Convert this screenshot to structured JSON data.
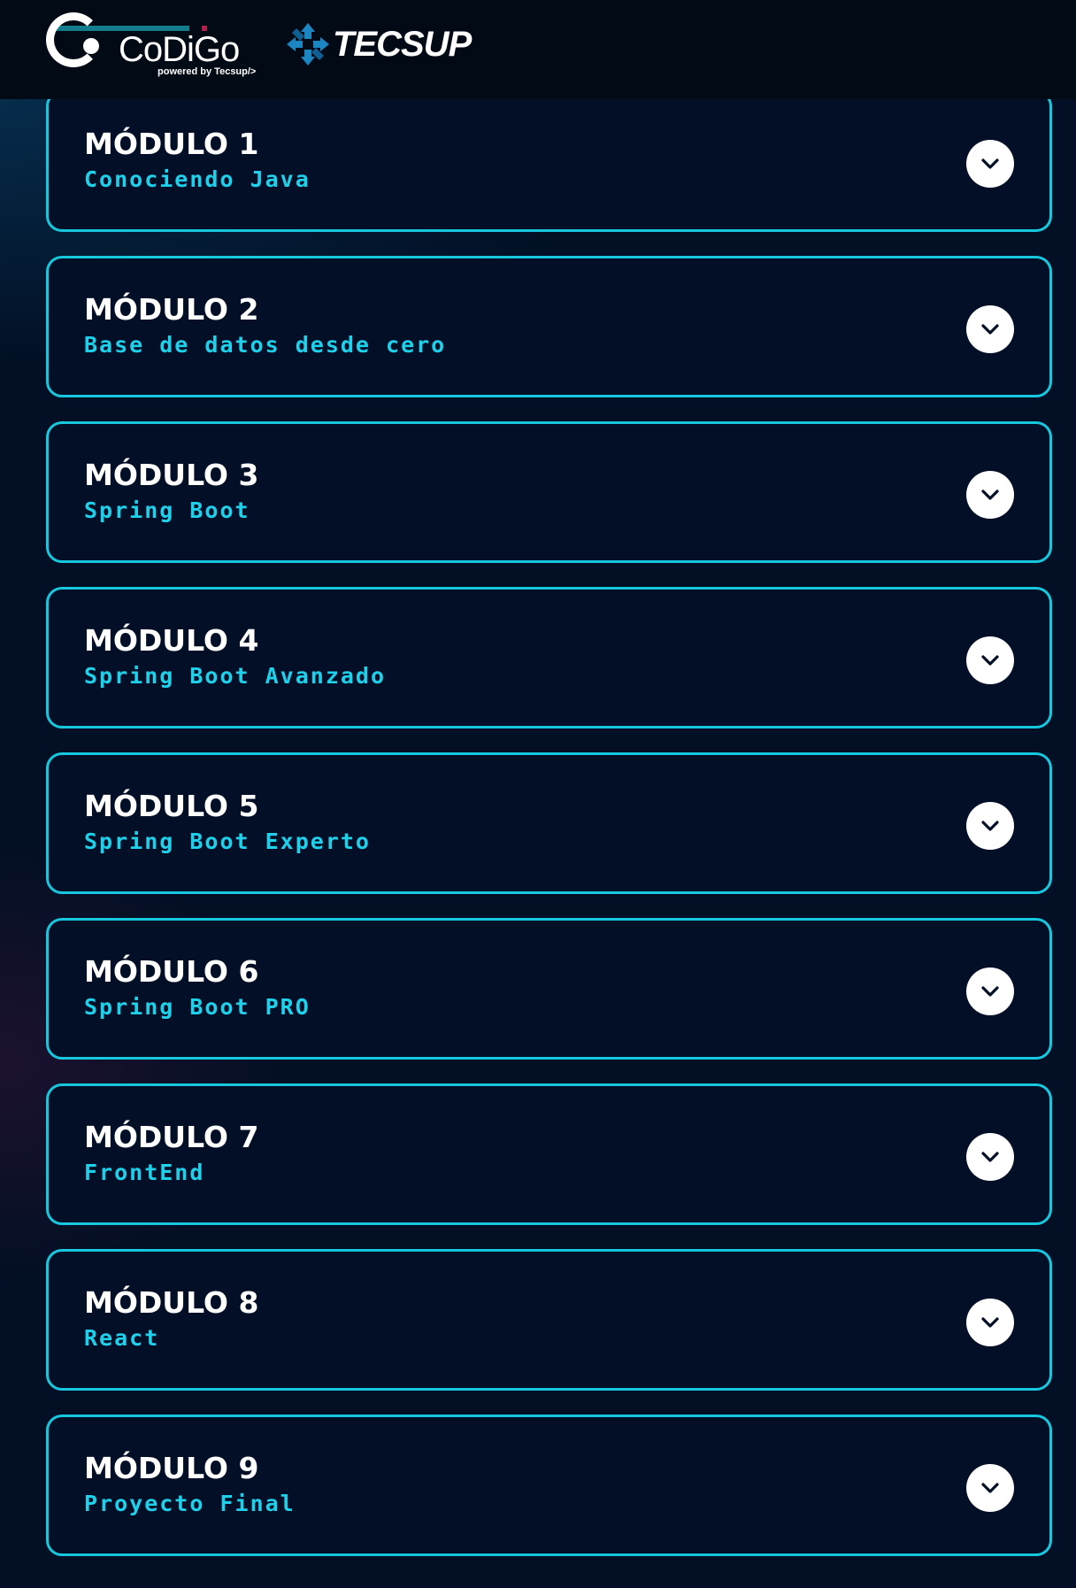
{
  "header": {
    "codigo_logo_text": "CoDiGo",
    "codigo_tagline": "powered by Tecsup/>",
    "tecsup_logo_text": "TECSUP"
  },
  "colors": {
    "background": "#020f24",
    "header_background": "#020a16",
    "accent_cyan": "#17c7de",
    "subtitle_cyan": "#1fd0ea",
    "title_white": "#ffffff"
  },
  "modules": [
    {
      "title": "MÓDULO 1",
      "subtitle": "Conociendo Java",
      "icon": "chevron-down-icon"
    },
    {
      "title": "MÓDULO 2",
      "subtitle": "Base de datos desde cero",
      "icon": "chevron-down-icon"
    },
    {
      "title": "MÓDULO 3",
      "subtitle": "Spring Boot",
      "icon": "chevron-down-icon"
    },
    {
      "title": "MÓDULO 4",
      "subtitle": "Spring Boot Avanzado",
      "icon": "chevron-down-icon"
    },
    {
      "title": "MÓDULO 5",
      "subtitle": "Spring Boot Experto",
      "icon": "chevron-down-icon"
    },
    {
      "title": "MÓDULO 6",
      "subtitle": "Spring Boot PRO",
      "icon": "chevron-down-icon"
    },
    {
      "title": "MÓDULO 7",
      "subtitle": "FrontEnd",
      "icon": "chevron-down-icon"
    },
    {
      "title": "MÓDULO 8",
      "subtitle": "React",
      "icon": "chevron-down-icon"
    },
    {
      "title": "MÓDULO 9",
      "subtitle": "Proyecto Final",
      "icon": "chevron-down-icon"
    }
  ]
}
